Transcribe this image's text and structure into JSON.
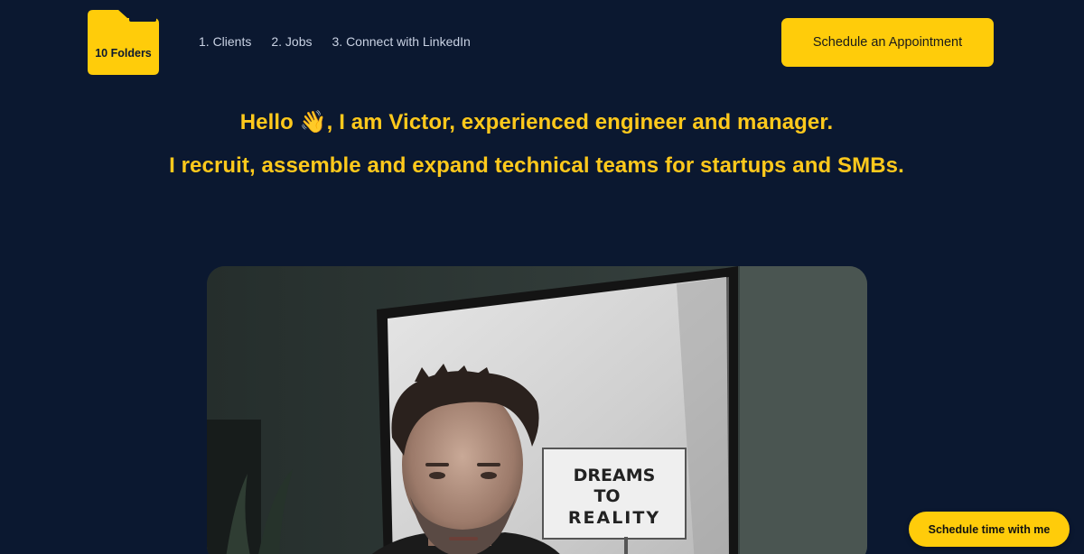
{
  "brand": {
    "logo_text": "10 Folders",
    "logo_icon": "folder-icon",
    "accent_color": "#ffcc0a",
    "background_color": "#0b1830"
  },
  "nav": {
    "items": [
      {
        "label": "1. Clients"
      },
      {
        "label": "2. Jobs"
      },
      {
        "label": "3. Connect with LinkedIn"
      }
    ]
  },
  "header": {
    "cta_label": "Schedule an Appointment"
  },
  "hero": {
    "line1": "Hello 👋, I am Victor, experienced engineer and manager.",
    "line2": "I recruit, assemble and expand technical teams for startups and SMBs."
  },
  "photo": {
    "sign_lines": [
      "DREAMS",
      "TO",
      "REALITY"
    ]
  },
  "floating": {
    "cta_label": "Schedule time with me"
  }
}
